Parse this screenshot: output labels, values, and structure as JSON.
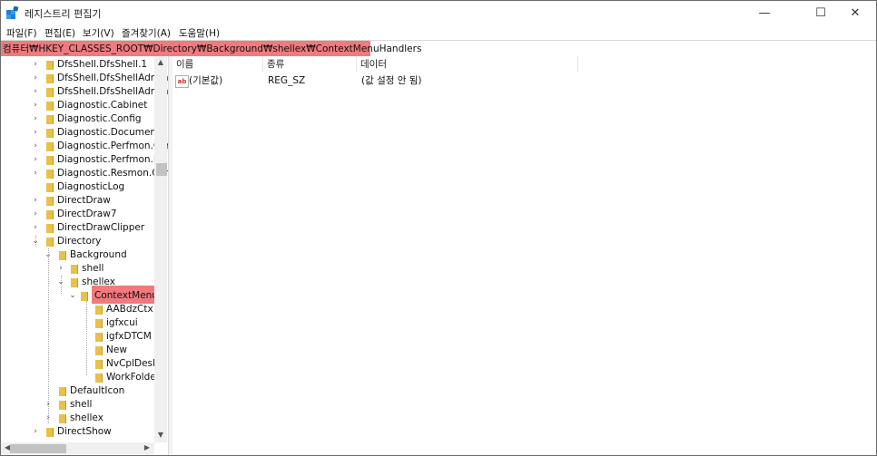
{
  "window": {
    "title": "레지스트리 편집기",
    "controls": {
      "minimize": "—",
      "maximize": "☐",
      "close": "✕"
    }
  },
  "menu": [
    "파일(F)",
    "편집(E)",
    "보기(V)",
    "즐겨찾기(A)",
    "도움말(H)"
  ],
  "address": "컴퓨터₩HKEY_CLASSES_ROOT₩Directory₩Background₩shellex₩ContextMenuHandlers",
  "tree": {
    "items": [
      {
        "label": "DfsShell.DfsShell.1",
        "arrow": "›"
      },
      {
        "label": "DfsShell.DfsShellAdmin",
        "arrow": "›"
      },
      {
        "label": "DfsShell.DfsShellAdmin",
        "arrow": "›"
      },
      {
        "label": "Diagnostic.Cabinet",
        "arrow": "›"
      },
      {
        "label": "Diagnostic.Config",
        "arrow": "›"
      },
      {
        "label": "Diagnostic.Document",
        "arrow": "›"
      },
      {
        "label": "Diagnostic.Perfmon.Cor",
        "arrow": "›"
      },
      {
        "label": "Diagnostic.Perfmon.Do",
        "arrow": "›"
      },
      {
        "label": "Diagnostic.Resmon.Cor",
        "arrow": "›"
      },
      {
        "label": "DiagnosticLog",
        "arrow": ""
      },
      {
        "label": "DirectDraw",
        "arrow": "›"
      },
      {
        "label": "DirectDraw7",
        "arrow": "›"
      },
      {
        "label": "DirectDrawClipper",
        "arrow": "›"
      },
      {
        "label": "Directory",
        "arrow": "⌄"
      },
      {
        "label": "Background",
        "arrow": "⌄"
      },
      {
        "label": "shell",
        "arrow": "›"
      },
      {
        "label": "shellex",
        "arrow": "⌄"
      },
      {
        "label": "ContextMenuHandlers",
        "arrow": "⌄"
      },
      {
        "label": "AABdzCtx",
        "arrow": ""
      },
      {
        "label": "igfxcui",
        "arrow": ""
      },
      {
        "label": "igfxDTCM",
        "arrow": ""
      },
      {
        "label": "New",
        "arrow": ""
      },
      {
        "label": "NvCplDesktopContext",
        "arrow": ""
      },
      {
        "label": "WorkFolders",
        "arrow": ""
      },
      {
        "label": "DefaultIcon",
        "arrow": ""
      },
      {
        "label": "shell",
        "arrow": "›"
      },
      {
        "label": "shellex",
        "arrow": "›"
      },
      {
        "label": "DirectShow",
        "arrow": "›"
      }
    ]
  },
  "list": {
    "headers": {
      "name": "이름",
      "type": "종류",
      "data": "데이터"
    },
    "rows": [
      {
        "icon": "ab",
        "name": "(기본값)",
        "type": "REG_SZ",
        "data": "(값 설정 안 됨)"
      }
    ]
  },
  "colors": {
    "highlight": "#f07a7e",
    "folder": "#e8c04a"
  }
}
